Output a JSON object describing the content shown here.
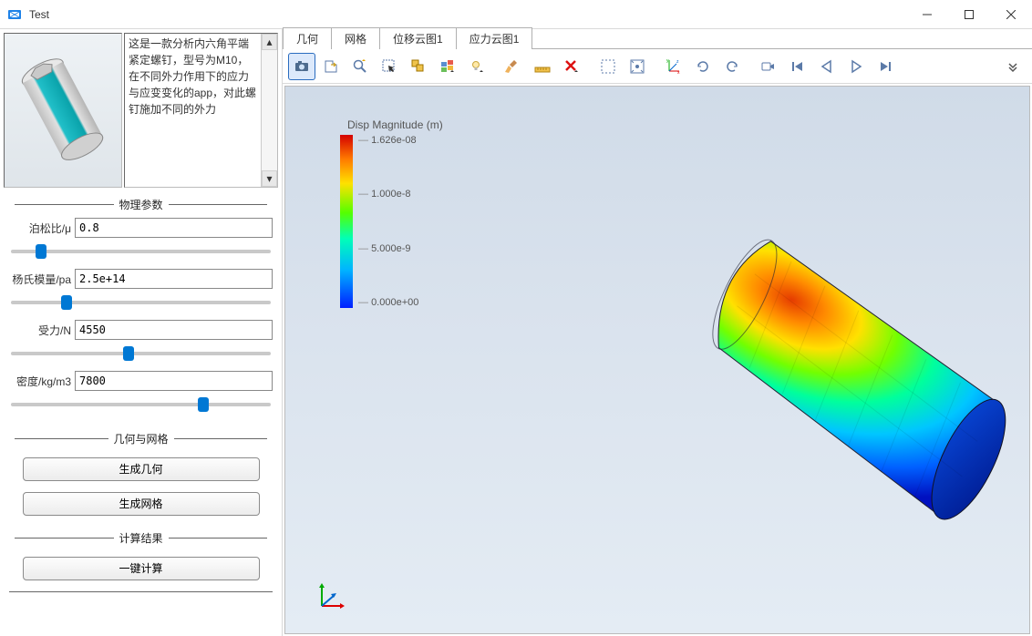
{
  "window": {
    "title": "Test"
  },
  "description": "这是一款分析内六角平端紧定螺钉，型号为M10，在不同外力作用下的应力与应变变化的app，对此螺钉施加不同的外力",
  "sections": {
    "physical_params": "物理参数",
    "geometry_mesh": "几何与网格",
    "results": "计算结果"
  },
  "params": {
    "poisson": {
      "label": "泊松比/μ",
      "value": "0.8",
      "slider": 10
    },
    "young": {
      "label": "杨氏模量/pa",
      "value": "2.5e+14",
      "slider": 20
    },
    "force": {
      "label": "受力/N",
      "value": "4550",
      "slider": 45
    },
    "density": {
      "label": "密度/kg/m3",
      "value": "7800",
      "slider": 75
    }
  },
  "buttons": {
    "gen_geometry": "生成几何",
    "gen_mesh": "生成网格",
    "compute": "一键计算"
  },
  "tabs": [
    "几何",
    "网格",
    "位移云图1",
    "应力云图1"
  ],
  "active_tab": 2,
  "legend": {
    "title": "Disp Magnitude (m)",
    "ticks": [
      "1.626e-08",
      "1.000e-8",
      "5.000e-9",
      "0.000e+00"
    ]
  },
  "icons": {
    "camera": "camera-icon",
    "export": "export-icon",
    "zoom": "zoom-icon",
    "pick": "pick-icon",
    "sel-box": "select-box-icon",
    "copy-win": "windows-icon",
    "lightbulb": "light-icon",
    "brush": "clean-icon",
    "ruler": "measure-icon",
    "delete": "delete-icon",
    "sel-rect": "rect-select-icon",
    "fit": "fit-icon",
    "axes": "axes-icon",
    "rotate-cw": "rotate-cw-icon",
    "rotate-ccw": "rotate-ccw-icon",
    "record": "record-icon",
    "first": "first-icon",
    "prev": "prev-icon",
    "play": "play-icon",
    "next": "next-icon",
    "more": "more-icon"
  }
}
